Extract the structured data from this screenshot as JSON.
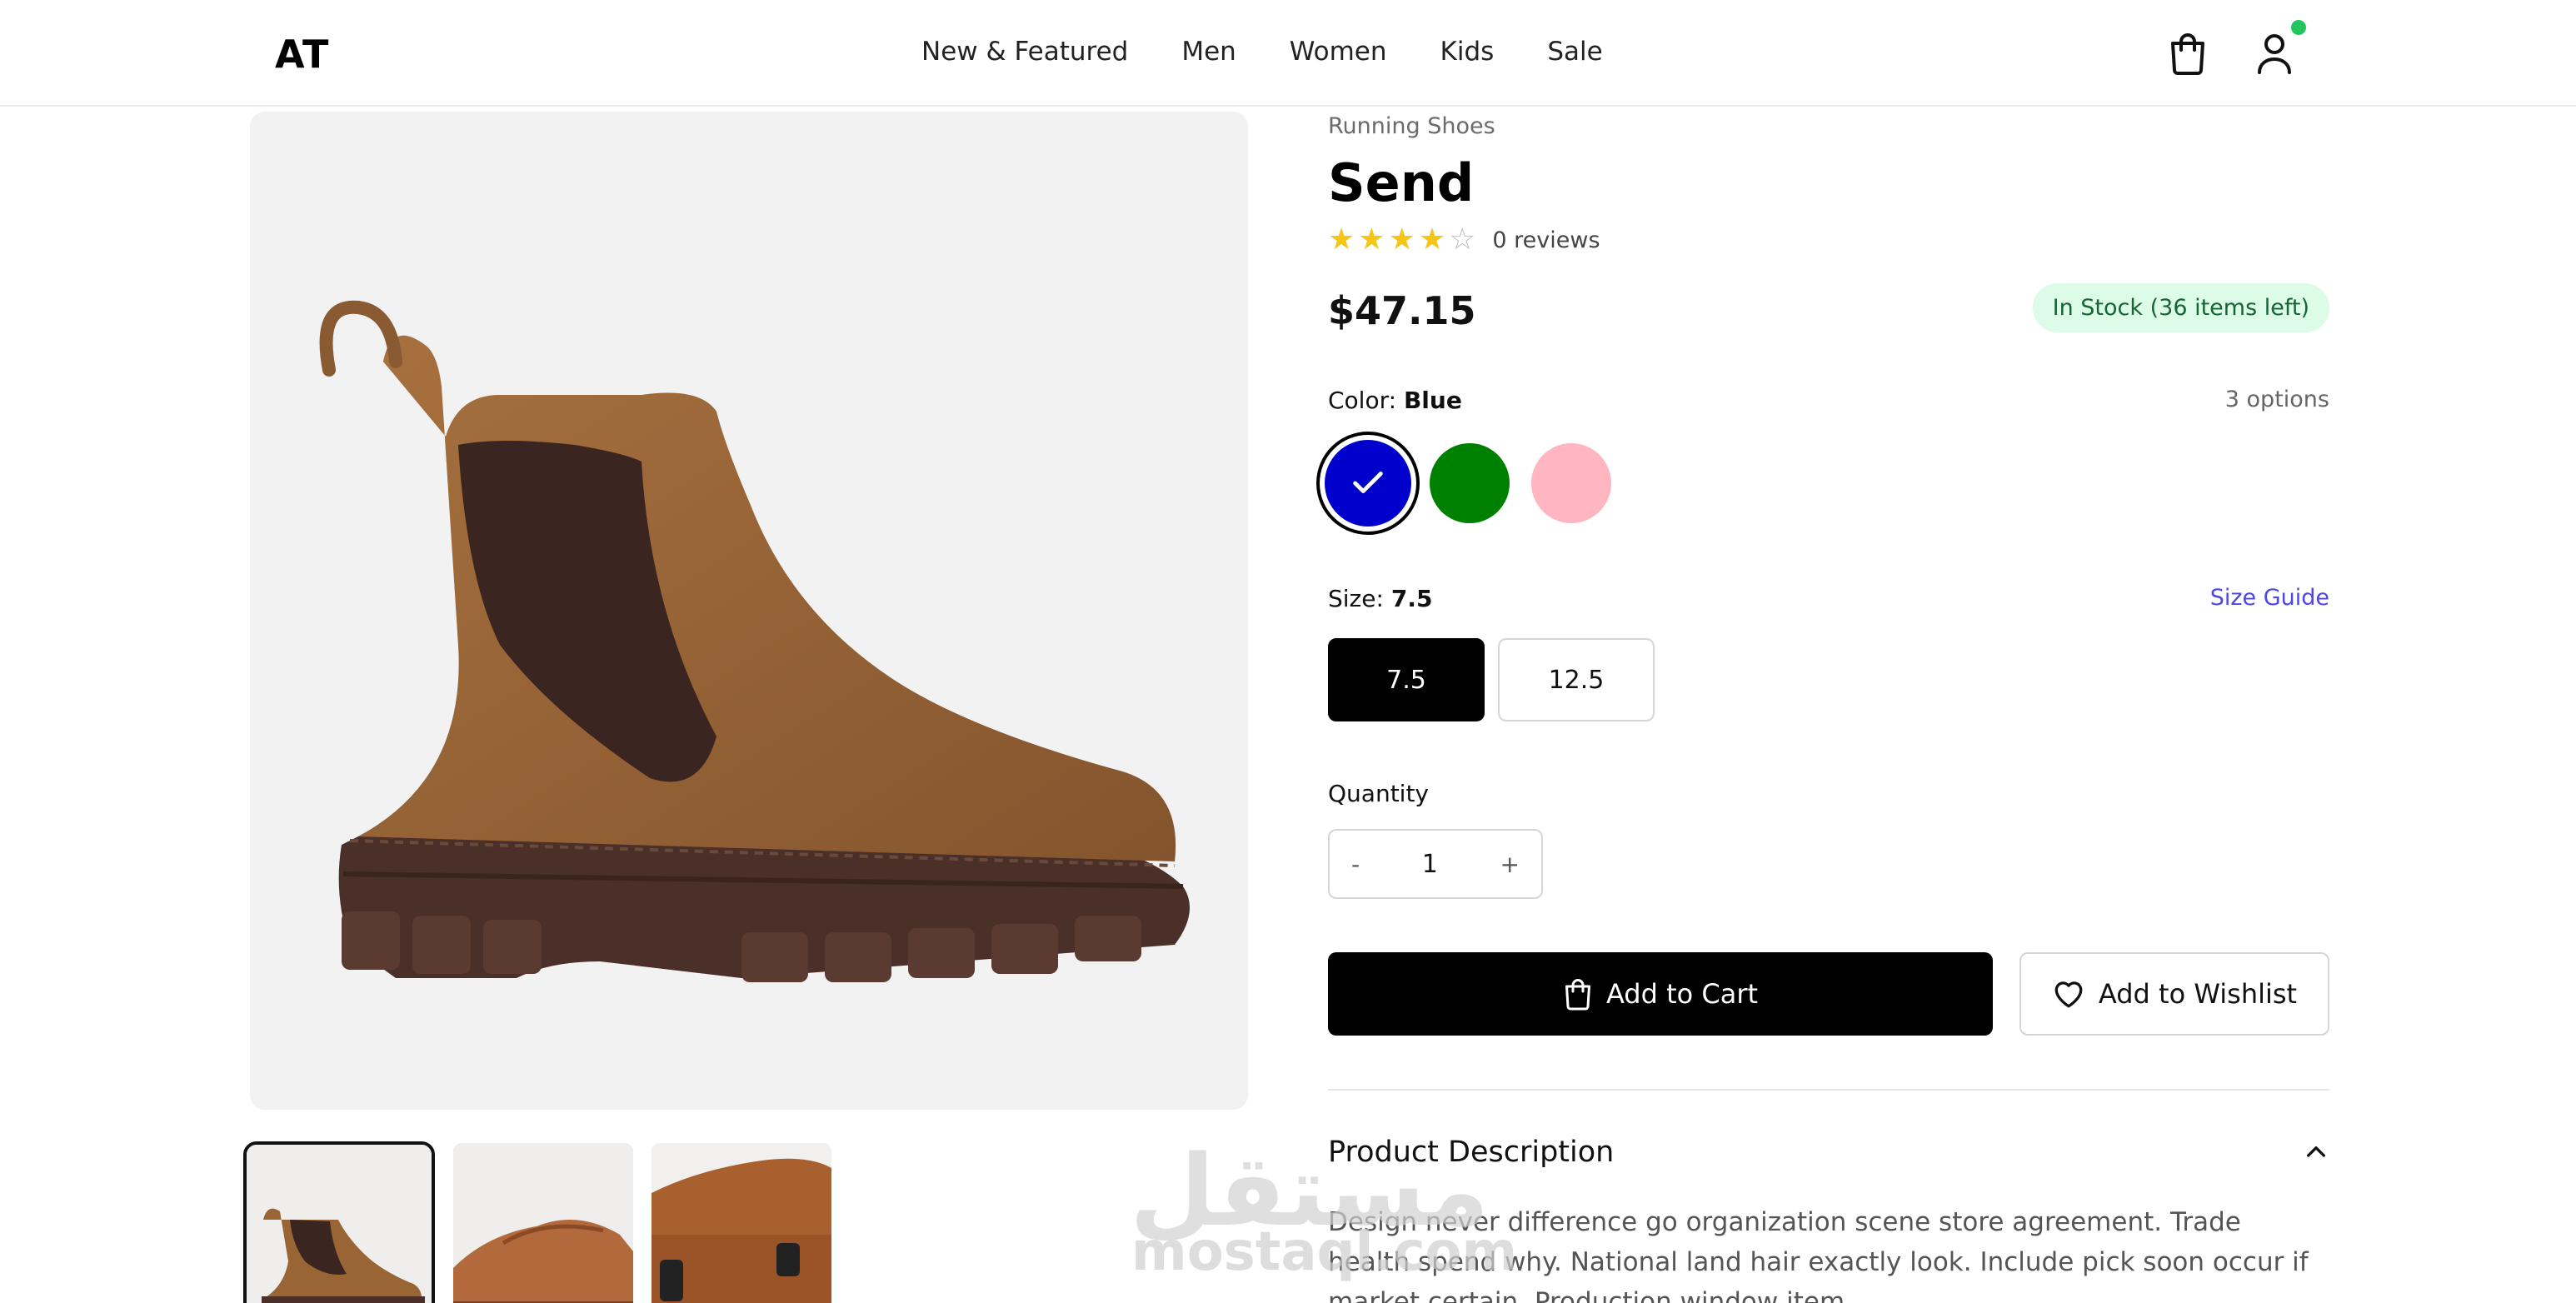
{
  "header": {
    "logo": "AT",
    "nav": [
      "New & Featured",
      "Men",
      "Women",
      "Kids",
      "Sale"
    ],
    "icons": {
      "cart": "shopping-bag-icon",
      "user": "user-icon"
    },
    "online_status_color": "#22c55e"
  },
  "gallery": {
    "main_image": "brown-suede-chelsea-boot",
    "thumbnails": [
      "brown-suede-chelsea-boot",
      "brown-leather-loafer",
      "brown-leather-loafer-detail"
    ],
    "active_thumbnail": 0
  },
  "product": {
    "category": "Running Shoes",
    "title": "Send",
    "rating": 4,
    "rating_max": 5,
    "reviews": "0 reviews",
    "price": "$47.15",
    "stock": "In Stock (36 items left)",
    "color": {
      "label": "Color:",
      "selected": "Blue",
      "options_count": "3 options",
      "swatches": [
        {
          "name": "Blue",
          "hex": "#0000cc",
          "selected": true
        },
        {
          "name": "Green",
          "hex": "#008000",
          "selected": false
        },
        {
          "name": "Pink",
          "hex": "#ffb6c1",
          "selected": false
        }
      ]
    },
    "size": {
      "label": "Size:",
      "selected": "7.5",
      "guide": "Size Guide",
      "options": [
        "7.5",
        "12.5"
      ]
    },
    "quantity": {
      "label": "Quantity",
      "value": "1",
      "minus": "-",
      "plus": "+"
    },
    "actions": {
      "add_to_cart": "Add to Cart",
      "add_to_wishlist": "Add to Wishlist"
    },
    "description": {
      "title": "Product Description",
      "text": "Design never difference go organization scene store agreement. Trade health spend why. National land hair exactly look. Include pick soon occur if market certain. Production window item."
    }
  },
  "watermark": {
    "arabic": "مستقل",
    "latin": "mostaql.com"
  },
  "colors": {
    "accent_link": "#4f46e5",
    "stock_bg": "#dcfce7",
    "stock_text": "#166534",
    "star": "#f5c518"
  }
}
